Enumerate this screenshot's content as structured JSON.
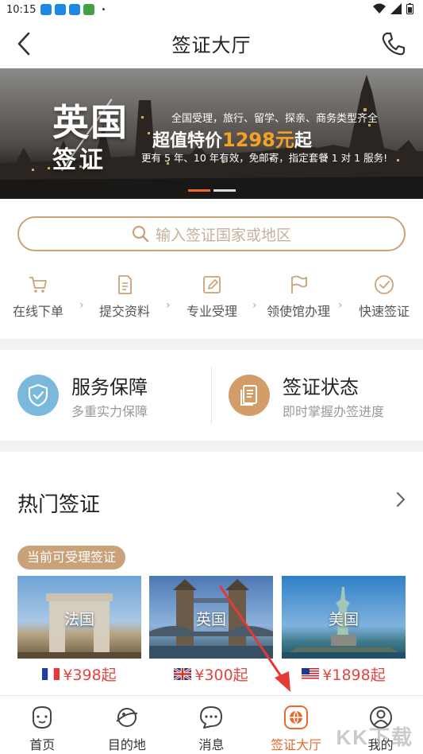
{
  "status_bar": {
    "time": "10:15",
    "app_icon_colors": [
      "#1e88e5",
      "#1e88e5",
      "#1e88e5",
      "#43a047"
    ],
    "dot": "•"
  },
  "header": {
    "title": "签证大厅",
    "back_icon": "back-arrow-icon",
    "phone_icon": "phone-icon"
  },
  "banner": {
    "big": "英国",
    "sub": "签证",
    "line1": "全国受理，旅行、留学、探亲、商务类型齐全",
    "price_prefix": "超值特价",
    "price_value": "1298元",
    "price_suffix": "起",
    "line3": "更有 5 年、10 年有效，免邮寄，指定套餐 1 对 1 服务!",
    "slides": 2,
    "active_slide": 0
  },
  "search": {
    "placeholder": "输入签证国家或地区",
    "icon": "search-icon"
  },
  "steps": [
    {
      "label": "在线下单",
      "icon": "cart-icon"
    },
    {
      "label": "提交资料",
      "icon": "document-icon"
    },
    {
      "label": "专业受理",
      "icon": "edit-icon"
    },
    {
      "label": "领使馆办理",
      "icon": "flag-icon"
    },
    {
      "label": "快速签证",
      "icon": "check-circle-icon"
    }
  ],
  "step_arrow": "›",
  "service_cards": [
    {
      "title": "服务保障",
      "subtitle": "多重实力保障",
      "icon": "shield-check-icon",
      "color": "#7ab8dc"
    },
    {
      "title": "签证状态",
      "subtitle": "即时掌握办签进度",
      "icon": "receipt-icon",
      "color": "#d39d6a"
    }
  ],
  "hot": {
    "title": "热门签证",
    "more_icon": "chevron-right-icon",
    "badge": "当前可受理签证",
    "visas": [
      {
        "name": "法国",
        "price": "¥398起",
        "flag": "france-flag-icon"
      },
      {
        "name": "英国",
        "price": "¥300起",
        "flag": "uk-flag-icon"
      },
      {
        "name": "美国",
        "price": "¥1898起",
        "flag": "us-flag-icon"
      }
    ]
  },
  "bottom_nav": [
    {
      "label": "首页",
      "icon": "home-face-icon",
      "active": false
    },
    {
      "label": "目的地",
      "icon": "planet-icon",
      "active": false
    },
    {
      "label": "消息",
      "icon": "chat-bubble-icon",
      "active": false
    },
    {
      "label": "签证大厅",
      "icon": "globe-icon",
      "active": true
    },
    {
      "label": "我的",
      "icon": "user-icon",
      "active": false
    }
  ],
  "colors": {
    "accent": "#e86a2c",
    "gold": "#c9a27a",
    "price_red": "#e2473c"
  },
  "watermark": "KK下载"
}
